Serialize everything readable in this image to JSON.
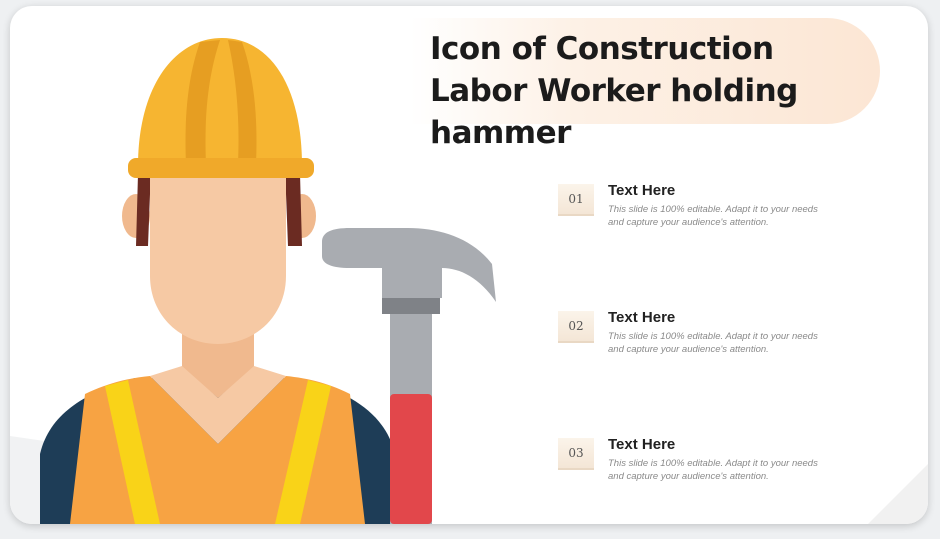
{
  "title": "Icon of Construction Labor Worker holding hammer",
  "items": [
    {
      "number": "01",
      "heading": "Text Here",
      "description": "This slide is 100% editable. Adapt it to your needs and capture your audience's attention."
    },
    {
      "number": "02",
      "heading": "Text Here",
      "description": "This slide is 100% editable. Adapt it to your needs and capture your audience's attention."
    },
    {
      "number": "03",
      "heading": "Text Here",
      "description": "This slide is 100% editable. Adapt it to your needs and capture your audience's attention."
    }
  ],
  "colors": {
    "helmet": "#f6b531",
    "skin": "#f6c9a4",
    "vest": "#f7a343",
    "stripe": "#f9d318",
    "shirt": "#1e3d57",
    "hammer_head": "#a9acb1",
    "handle_grip": "#e2474b",
    "accent_band": "#fce6d4"
  }
}
